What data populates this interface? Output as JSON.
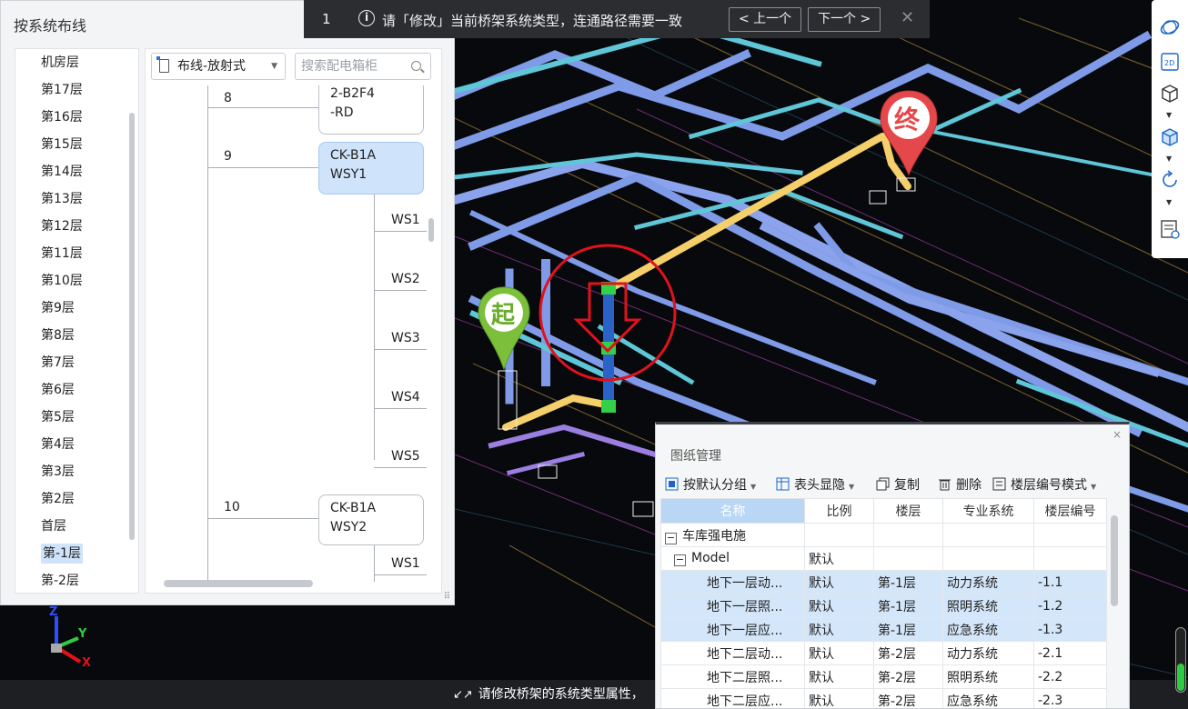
{
  "system_panel": {
    "title": "按系统布线",
    "floors": [
      "机房层",
      "第17层",
      "第16层",
      "第15层",
      "第14层",
      "第13层",
      "第12层",
      "第11层",
      "第10层",
      "第9层",
      "第8层",
      "第7层",
      "第6层",
      "第5层",
      "第4层",
      "第3层",
      "第2层",
      "首层",
      "第-1层",
      "第-2层"
    ],
    "selected_floor": "第-1层",
    "mode_select": "布线-放射式",
    "search_placeholder": "搜索配电箱柜",
    "tree": {
      "n8": "8",
      "b8a": "2-B2F4",
      "b8b": "-RD",
      "n9": "9",
      "b9a": "CK-B1A",
      "b9b": "WSY1",
      "leaves9": [
        "WS1",
        "WS2",
        "WS3",
        "WS4",
        "WS5"
      ],
      "n10": "10",
      "b10a": "CK-B1A",
      "b10b": "WSY2",
      "leaf10": "WS1"
    }
  },
  "issue_bar": {
    "index": "1",
    "info_icon": "i",
    "message": "请「修改」当前桥架系统类型，连通路径需要一致",
    "prev": "< 上一个",
    "next": "下一个 >",
    "close": "✕"
  },
  "markers": {
    "start": "起",
    "end": "终"
  },
  "axis": {
    "x": "X",
    "y": "Y",
    "z": "Z"
  },
  "status_message": "请修改桥架的系统类型属性，",
  "drawing_manager": {
    "title": "图纸管理",
    "close": "×",
    "toolbar": {
      "group": "按默认分组",
      "header": "表头显隐",
      "copy": "复制",
      "delete": "删除",
      "floor_mode": "楼层编号模式"
    },
    "columns": [
      "名称",
      "比例",
      "楼层",
      "专业系统",
      "楼层编号"
    ],
    "group_root": "车库强电施",
    "group_model": "Model",
    "group_model_scale": "默认",
    "rows": [
      {
        "name": "地下一层动...",
        "scale": "默认",
        "floor": "第-1层",
        "system": "动力系统",
        "code": "-1.1",
        "hl": true
      },
      {
        "name": "地下一层照...",
        "scale": "默认",
        "floor": "第-1层",
        "system": "照明系统",
        "code": "-1.2",
        "hl": true
      },
      {
        "name": "地下一层应...",
        "scale": "默认",
        "floor": "第-1层",
        "system": "应急系统",
        "code": "-1.3",
        "hl": true
      },
      {
        "name": "地下二层动...",
        "scale": "默认",
        "floor": "第-2层",
        "system": "动力系统",
        "code": "-2.1",
        "hl": false
      },
      {
        "name": "地下二层照...",
        "scale": "默认",
        "floor": "第-2层",
        "system": "照明系统",
        "code": "-2.2",
        "hl": false
      },
      {
        "name": "地下二层应...",
        "scale": "默认",
        "floor": "第-2层",
        "system": "应急系统",
        "code": "-2.3",
        "hl": false
      }
    ]
  },
  "colors": {
    "tray_blue": "#7f9be8",
    "tray_cyan": "#5fc6d8",
    "route_yellow": "#f5cf6a",
    "highlight_red": "#e0121c",
    "start_green": "#7cbf3a",
    "end_red": "#e4484a",
    "selection_blue": "#cfe3fb"
  }
}
